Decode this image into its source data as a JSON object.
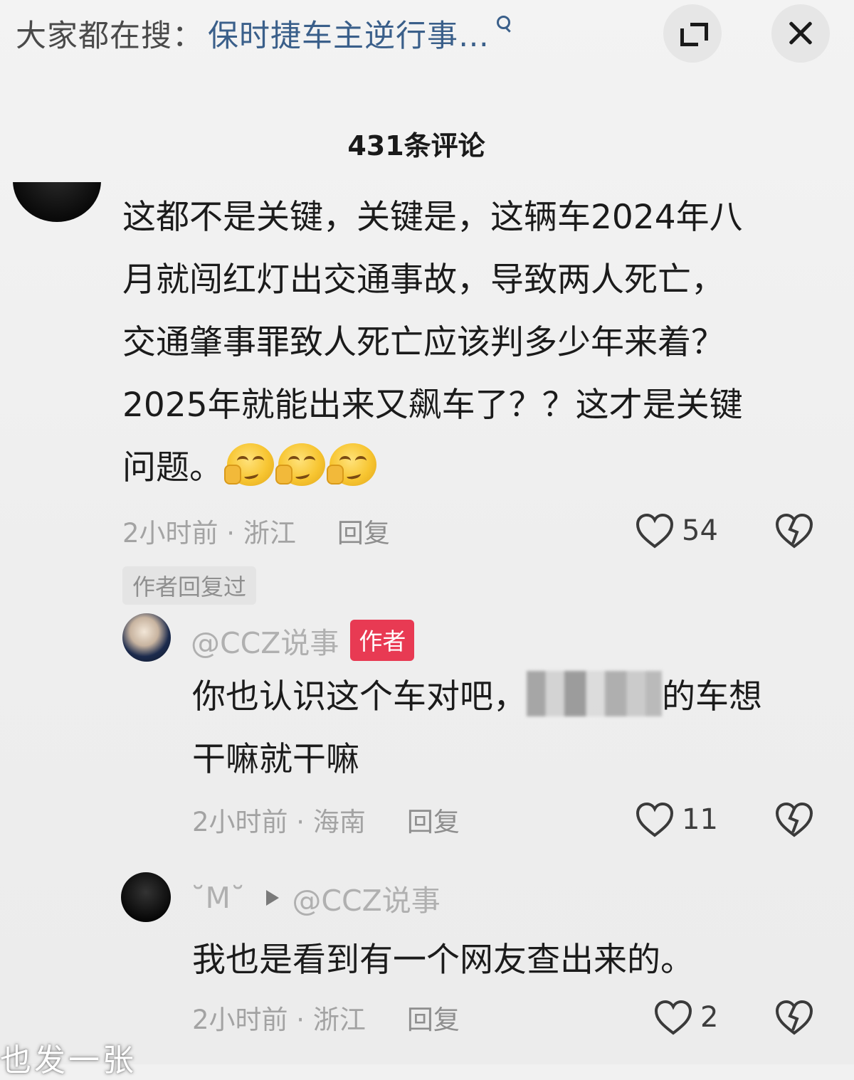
{
  "search": {
    "prefix": "大家都在搜：",
    "query": "保时捷车主逆行事…"
  },
  "comments_header": {
    "count_label": "431条评论"
  },
  "main_comment": {
    "line1": "这都不是关键，关键是，这辆车2024年八",
    "line2": "月就闯红灯出交通事故，导致两人死亡，",
    "line3": "交通肇事罪致人死亡应该判多少年来着？",
    "line4": "2025年就能出来又飙车了？？这才是关键",
    "line5": "问题。",
    "emojis": [
      "thinking-face",
      "thinking-face",
      "thinking-face"
    ],
    "time_location": "2小时前 · 浙江",
    "reply_label": "回复",
    "likes": "54",
    "author_replied_tag": "作者回复过"
  },
  "reply_author": {
    "username": "@CCZ说事",
    "badge": "作者",
    "text_before_blur": "你也认识这个车对吧，",
    "text_after_blur": "的车想",
    "line2": "干嘛就干嘛",
    "time_location": "2小时前 · 海南",
    "reply_label": "回复",
    "likes": "11"
  },
  "reply_m": {
    "username": "˘M˘",
    "reply_to": "@CCZ说事",
    "text": "我也是看到有一个网友查出来的。",
    "time_location": "2小时前 · 浙江",
    "reply_label": "回复",
    "likes": "2"
  },
  "overlay": {
    "text": "也发一张"
  },
  "colors": {
    "background": "#efefef",
    "link_blue": "#3a5f8a",
    "author_badge": "#e83a53",
    "meta_gray": "#a3a3a3"
  }
}
